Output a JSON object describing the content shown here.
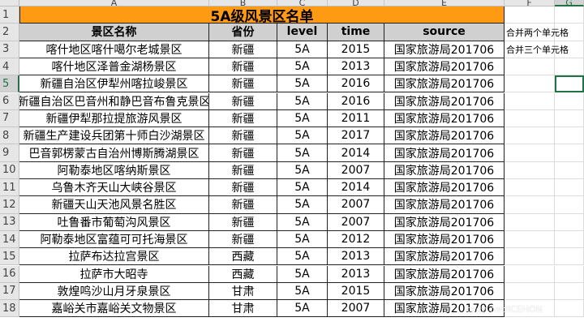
{
  "column_headers": [
    "A",
    "B",
    "C",
    "D",
    "E",
    "F",
    "G"
  ],
  "row_numbers": [
    "1",
    "2",
    "3",
    "4",
    "5",
    "6",
    "7",
    "8",
    "9",
    "10",
    "11",
    "12",
    "13",
    "14",
    "15",
    "16",
    "17",
    "18"
  ],
  "active_cell": "G5",
  "title": "5A级风景区名单",
  "table_headers": [
    "景区名称",
    "省份",
    "level",
    "time",
    "source"
  ],
  "rows": [
    [
      "喀什地区喀什噶尔老城景区",
      "新疆",
      "5A",
      "2015",
      "国家旅游局201706"
    ],
    [
      "喀什地区泽普金湖杨景区",
      "新疆",
      "5A",
      "2013",
      "国家旅游局201706"
    ],
    [
      "新疆自治区伊犁州喀拉峻景区",
      "新疆",
      "5A",
      "2016",
      "国家旅游局201706"
    ],
    [
      "新疆自治区巴音州和静巴音布鲁克景区",
      "新疆",
      "5A",
      "2016",
      "国家旅游局201706"
    ],
    [
      "新疆伊犁那拉提旅游风景区",
      "新疆",
      "5A",
      "2011",
      "国家旅游局201706"
    ],
    [
      "新疆生产建设兵团第十师白沙湖景区",
      "新疆",
      "5A",
      "2017",
      "国家旅游局201706"
    ],
    [
      "巴音郭楞蒙古自治州博斯腾湖景区",
      "新疆",
      "5A",
      "2014",
      "国家旅游局201706"
    ],
    [
      "阿勒泰地区喀纳斯景区",
      "新疆",
      "5A",
      "2007",
      "国家旅游局201706"
    ],
    [
      "乌鲁木齐天山大峡谷景区",
      "新疆",
      "5A",
      "2014",
      "国家旅游局201706"
    ],
    [
      "新疆天山天池风景名胜区",
      "新疆",
      "5A",
      "2007",
      "国家旅游局201706"
    ],
    [
      "吐鲁番市葡萄沟风景区",
      "新疆",
      "5A",
      "2007",
      "国家旅游局201706"
    ],
    [
      "阿勒泰地区富蕴可可托海景区",
      "新疆",
      "5A",
      "2012",
      "国家旅游局201706"
    ],
    [
      "拉萨布达拉宫景区",
      "西藏",
      "5A",
      "2013",
      "国家旅游局201706"
    ],
    [
      "拉萨市大昭寺",
      "西藏",
      "5A",
      "2013",
      "国家旅游局201706"
    ],
    [
      "敦煌鸣沙山月牙泉景区",
      "甘肃",
      "5A",
      "2015",
      "国家旅游局201706"
    ],
    [
      "嘉峪关市嘉峪关文物景区",
      "甘肃",
      "5A",
      "2007",
      "国家旅游局201706"
    ]
  ],
  "notes": {
    "f2": "合并两个单元格",
    "f3": "合并三个单元格"
  },
  "watermark": "csdn.net/ICEHON"
}
